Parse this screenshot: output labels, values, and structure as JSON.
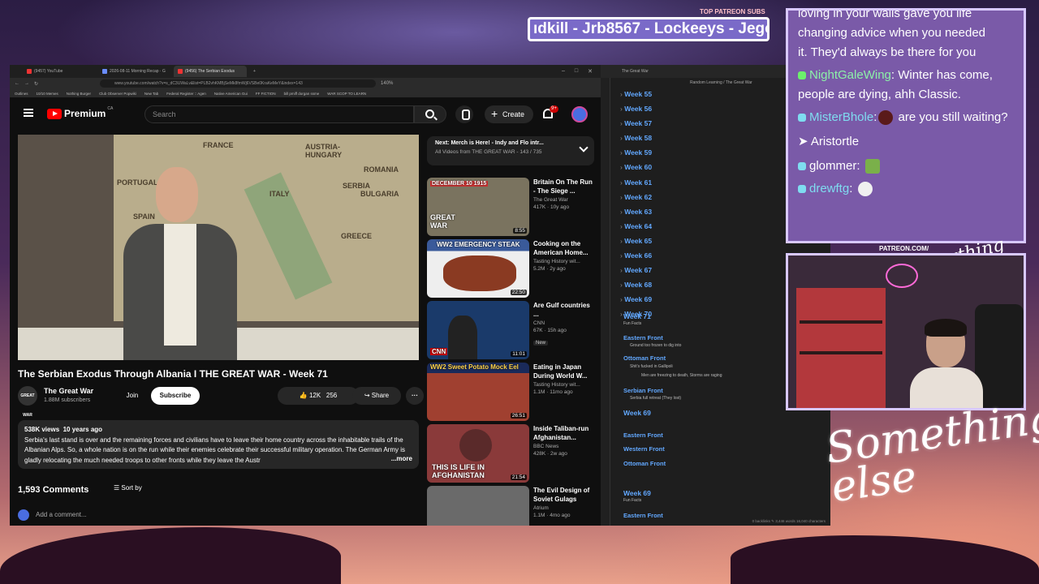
{
  "top_patreon_label": "TOP PATREON SUBS",
  "ticker": "ıdkill - Jrb8567 - Lockeeys - Jego",
  "browser": {
    "tabs": [
      "(9457) YouTube",
      "2026-08-11 Morning Recap · G",
      "(9456) The Serbian Exodus"
    ],
    "url": "www.youtube.com/watch?v=s_dC3UWaLv&list=PLB2vhKMBjSeMk8fmWj6VSBe0KraKeMeY&index=143",
    "zoom": "140%",
    "bookmarks": [
      "Outlines",
      "10/10 Memes",
      "Nothing Burger",
      "Club Observer Popwiki",
      "New Tab",
      "Federal Register :: Agen",
      "Native American Gui",
      "FF FICTION",
      "bill pmiff dorgan ssme",
      "WAR SCOP TO LEARN"
    ]
  },
  "youtube": {
    "logo_text": "Premium",
    "logo_region": "CA",
    "search_placeholder": "Search",
    "create_label": "Create",
    "notif_count": "9+",
    "map_labels": [
      "FRANCE",
      "AUSTRIA-HUNGARY",
      "ROMANIA",
      "PORTUGAL",
      "ITALY",
      "SERBIA",
      "BULGARIA",
      "SPAIN",
      "GREECE"
    ],
    "video_title": "The Serbian Exodus Through Albania I THE GREAT WAR - Week 71",
    "channel_name": "The Great War",
    "channel_avatar_text": "GREAT WAR",
    "channel_subs": "1.88M subscribers",
    "join_label": "Join",
    "subscribe_label": "Subscribe",
    "likes": "12K",
    "dislike_count": "256",
    "share_label": "Share",
    "views": "538K views",
    "age": "10 years ago",
    "description": "Serbia's last stand is over and the remaining forces and civilians have to leave their home country across the inhabitable trails of the Albanian Alps. So, a whole nation is on the run while their enemies celebrate their successful military operation. The German Army is gladly relocating the much needed troops to other fronts while they leave the Austr",
    "more_label": "...more",
    "comments_count": "1,593 Comments",
    "sort_label": "Sort by",
    "add_comment": "Add a comment...",
    "next_title": "Next: Merch is Here! - Indy and Flo intr...",
    "next_sub": "All Videos from THE GREAT WAR - 143 / 735",
    "recs": [
      {
        "title": "Britain On The Run - The Siege ...",
        "channel": "The Great War",
        "meta": "417K · 10y ago",
        "duration": "8:55",
        "thumb_text": "GREAT WAR",
        "thumb_top": "DECEMBER 10 1915",
        "color": "#7a735f"
      },
      {
        "title": "Cooking on the American Home...",
        "channel": "Tasting History wit...",
        "meta": "5.2M · 2y ago",
        "duration": "22:50",
        "thumb_text": "WW2 EMERGENCY STEAK",
        "thumb_top": "",
        "color": "#3a5a9a"
      },
      {
        "title": "Are Gulf countries ...",
        "channel": "CNN",
        "meta": "67K · 15h ago",
        "duration": "11:01",
        "thumb_text": "CNN",
        "thumb_top": "",
        "color": "#1a3a6a",
        "new": "New"
      },
      {
        "title": "Eating in Japan During World W...",
        "channel": "Tasting History wit...",
        "meta": "1.1M · 11mo ago",
        "duration": "26:51",
        "thumb_text": "WW2 Sweet Potato Mock Eel",
        "thumb_top": "",
        "color": "#a04030"
      },
      {
        "title": "Inside Taliban-run Afghanistan...",
        "channel": "BBC News",
        "meta": "428K · 2w ago",
        "duration": "21:54",
        "thumb_text": "THIS IS LIFE IN AFGHANISTAN",
        "thumb_top": "",
        "color": "#8a3a3a"
      },
      {
        "title": "The Evil Design of Soviet Gulags",
        "channel": "Atrium",
        "meta": "1.1M · 4mo ago",
        "duration": "",
        "thumb_text": "",
        "thumb_top": "",
        "color": "#6a6a6a"
      }
    ]
  },
  "obsidian": {
    "tab": "The Great War",
    "crumb": "Random Learning / The Great War",
    "weeks": [
      "Week 55",
      "Week 56",
      "Week 57",
      "Week 58",
      "Week 59",
      "Week 60",
      "Week 61",
      "Week 62",
      "Week 63",
      "Week 64",
      "Week 65",
      "Week 66",
      "Week 67",
      "Week 68",
      "Week 69",
      "Week 70"
    ],
    "week71": "Week 71",
    "fun_facts": "Fun Facts",
    "eastern": "Eastern Front",
    "eastern_note": "Ground too frozen to dig into",
    "ottoman": "Ottoman Front",
    "ottoman_note1": "Shit's fucked in Gallipoli",
    "ottoman_note2": "Men are freezing to death, Storms are raging",
    "serbian": "Serbian Front",
    "serbian_note": "Serbia full retreat (They lost)",
    "week69": "Week 69",
    "eastern2": "Eastern Front",
    "western2": "Western Front",
    "ottoman2": "Ottoman Front",
    "week69b": "Week 69",
    "fun_facts2": "Fun Facts",
    "eastern3": "Eastern Front",
    "status": "0 backlinks  ✎  3,446 words  16,040 characters"
  },
  "chat": {
    "line0a": "loving in your walls gave you life",
    "line0b": "changing advice when you needed",
    "line0c": "it. They'd always be there for you",
    "m1_user": "NightGaleWing",
    "m1_text": ": Winter has come, people are dying, ahh Classic.",
    "m2_user": "MisterBhole",
    "m2_text": " are you still waiting?",
    "m3_user": "Aristortle",
    "m4_user": "glommer",
    "m5_user": "drewftg"
  },
  "overlay": {
    "patreon": "PATREON.COM/",
    "script_small": "Anything else?",
    "script_big": "Something else"
  }
}
